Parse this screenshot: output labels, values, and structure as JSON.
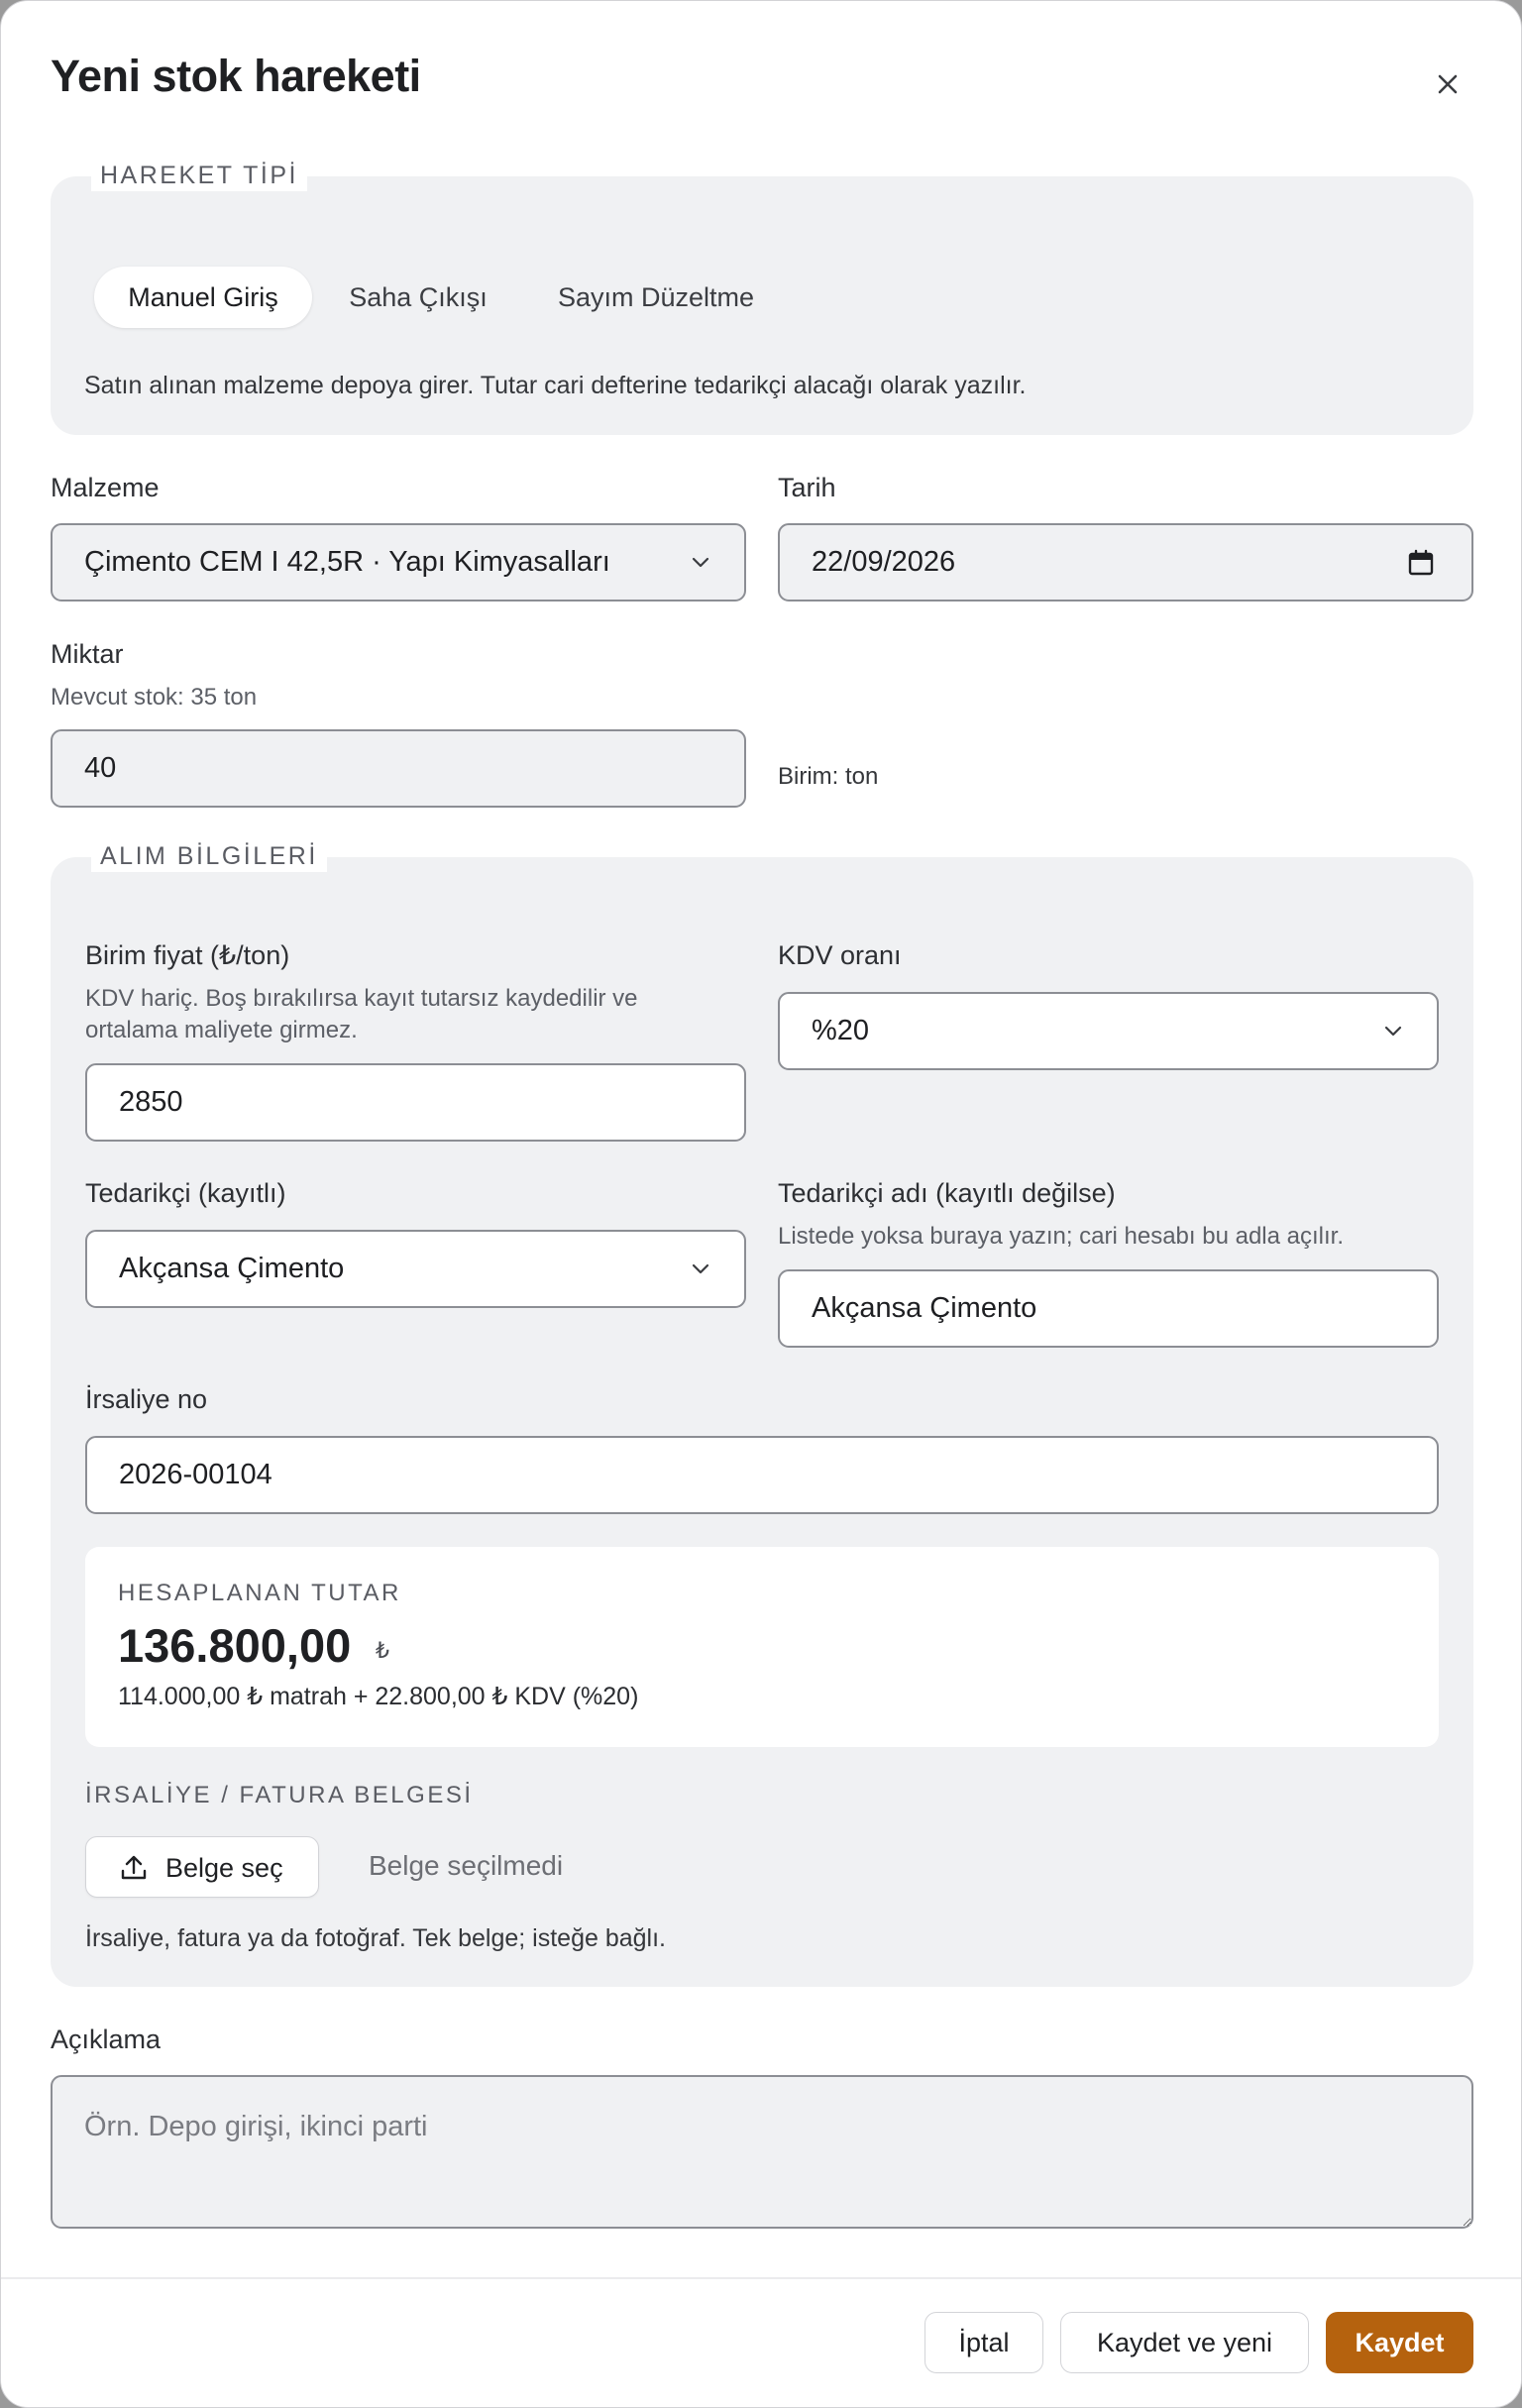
{
  "dialog": {
    "title": "Yeni stok hareketi",
    "close_icon": "close-icon"
  },
  "movement_type": {
    "legend": "HAREKET TİPİ",
    "options": [
      "Manuel Giriş",
      "Saha Çıkışı",
      "Sayım Düzeltme"
    ],
    "selected": "Manuel Giriş",
    "description": "Satın alınan malzeme depoya girer. Tutar cari defterine tedarikçi alacağı olarak yazılır."
  },
  "material": {
    "label": "Malzeme",
    "value": "Çimento CEM I 42,5R · Yapı Kimyasalları"
  },
  "date": {
    "label": "Tarih",
    "value": "22/09/2026"
  },
  "quantity": {
    "label": "Miktar",
    "hint": "Mevcut stok: 35 ton",
    "value": "40",
    "unit_text": "Birim: ton"
  },
  "purchase": {
    "legend": "ALIM BİLGİLERİ",
    "unit_price": {
      "label": "Birim fiyat (₺/ton)",
      "hint_line1": "KDV hariç. Boş bırakılırsa kayıt tutarsız kaydedilir ve",
      "hint_line2": "ortalama maliyete girmez.",
      "value": "2850"
    },
    "vat": {
      "label": "KDV oranı",
      "value": "%20"
    },
    "supplier": {
      "label": "Tedarikçi (kayıtlı)",
      "value": "Akçansa Çimento"
    },
    "supplier_name": {
      "label": "Tedarikçi adı (kayıtlı değilse)",
      "hint": "Listede yoksa buraya yazın; cari hesabı bu adla açılır.",
      "value": "Akçansa Çimento"
    },
    "waybill": {
      "label": "İrsaliye no",
      "value": "2026-00104"
    },
    "summary": {
      "caption": "HESAPLANAN TUTAR",
      "amount": "136.800,00",
      "currency": "₺",
      "detail": "114.000,00 ₺ matrah + 22.800,00 ₺ KDV (%20)"
    },
    "document": {
      "legend": "İRSALİYE / FATURA BELGESİ",
      "button_label": "Belge seç",
      "status": "Belge seçilmedi",
      "hint": "İrsaliye, fatura ya da fotoğraf. Tek belge; isteğe bağlı."
    }
  },
  "note": {
    "label": "Açıklama",
    "placeholder": "Örn. Depo girişi, ikinci parti"
  },
  "footer": {
    "cancel": "İptal",
    "save_new": "Kaydet ve yeni",
    "save": "Kaydet"
  },
  "colors": {
    "primary": "#b5620e",
    "section_bg": "#f0f1f3",
    "field_border": "#8c8e94"
  }
}
